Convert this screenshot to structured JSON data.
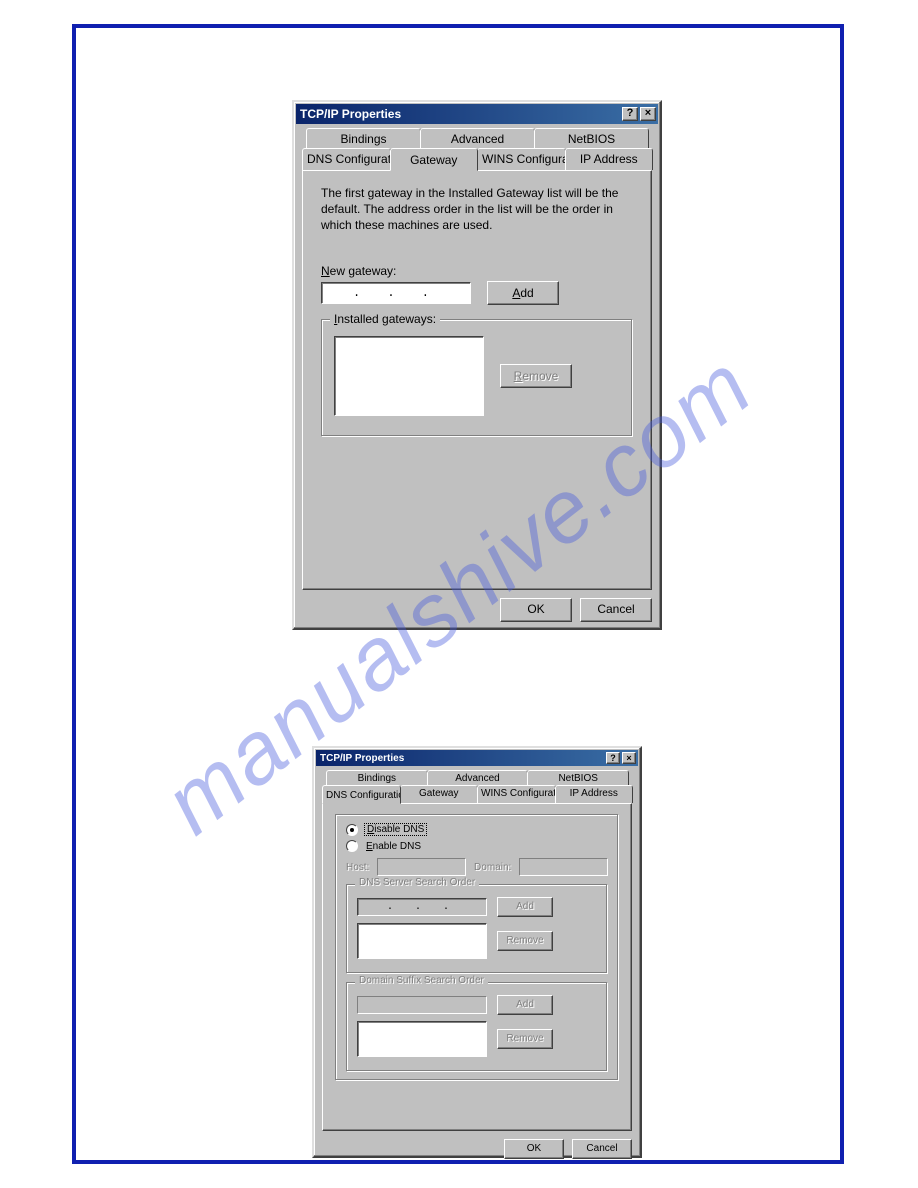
{
  "watermark": "manualshive.com",
  "win1": {
    "title": "TCP/IP Properties",
    "help_glyph": "?",
    "close_glyph": "×",
    "tabs_back": [
      "Bindings",
      "Advanced",
      "NetBIOS"
    ],
    "tabs_front": [
      "DNS Configuration",
      "Gateway",
      "WINS Configuration",
      "IP Address"
    ],
    "active_tab": "Gateway",
    "info": "The first gateway in the Installed Gateway list will be the default. The address order in the list will be the order in which these machines are used.",
    "new_gateway_label_pre": "N",
    "new_gateway_label_rest": "ew gateway:",
    "ip_dots": ". . .",
    "add_label_pre": "A",
    "add_label_rest": "dd",
    "installed_label_pre": "I",
    "installed_label_rest": "nstalled gateways:",
    "remove_label_pre": "R",
    "remove_label_rest": "emove",
    "ok": "OK",
    "cancel": "Cancel"
  },
  "win2": {
    "title": "TCP/IP Properties",
    "help_glyph": "?",
    "close_glyph": "×",
    "tabs_back": [
      "Bindings",
      "Advanced",
      "NetBIOS"
    ],
    "tabs_front": [
      "DNS Configuration",
      "Gateway",
      "WINS Configuration",
      "IP Address"
    ],
    "active_tab": "DNS Configuration",
    "disable_dns_pre": "D",
    "disable_dns_rest": "isable DNS",
    "enable_dns_pre": "E",
    "enable_dns_rest": "nable DNS",
    "host_label": "Host:",
    "domain_label": "Domain:",
    "dns_order_legend": "DNS Server Search Order",
    "domain_suffix_legend": "Domain Suffix Search Order",
    "ip_dots": ". . .",
    "add_label": "Add",
    "remove_label": "Remove",
    "ok": "OK",
    "cancel": "Cancel"
  }
}
